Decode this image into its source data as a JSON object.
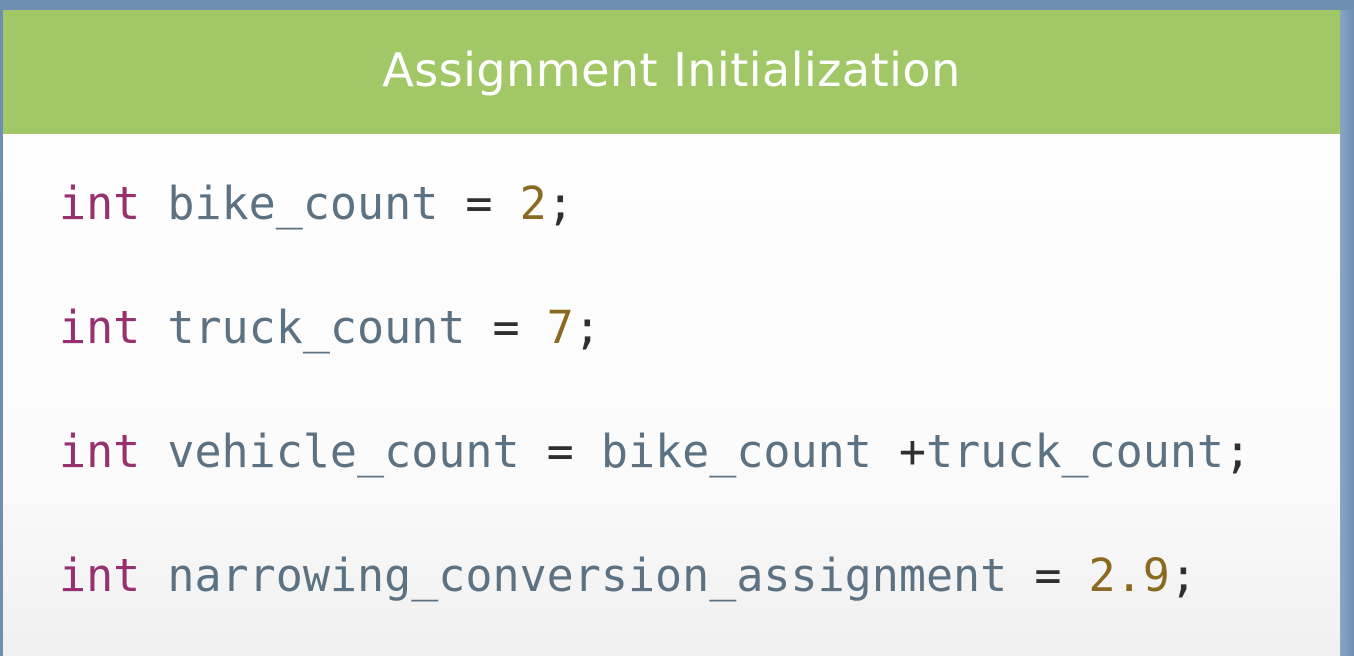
{
  "slide": {
    "title": "Assignment Initialization"
  },
  "code": {
    "lines": [
      {
        "keyword": "int",
        "name": "bike_count",
        "op": "=",
        "value": "2",
        "end": ";"
      },
      {
        "keyword": "int",
        "name": "truck_count",
        "op": "=",
        "value": "7",
        "end": ";"
      },
      {
        "keyword": "int",
        "name": "vehicle_count",
        "op": "=",
        "operand1": "bike_count",
        "plus": "+",
        "operand2": "truck_count",
        "end": ";"
      },
      {
        "keyword": "int",
        "name": "narrowing_conversion_assignment",
        "op": "=",
        "value": "2.9",
        "end": ";"
      }
    ]
  },
  "colors": {
    "title_bar": "#a2c766",
    "keyword": "#97306e",
    "identifier": "#5c7283",
    "number": "#8a6a20"
  }
}
